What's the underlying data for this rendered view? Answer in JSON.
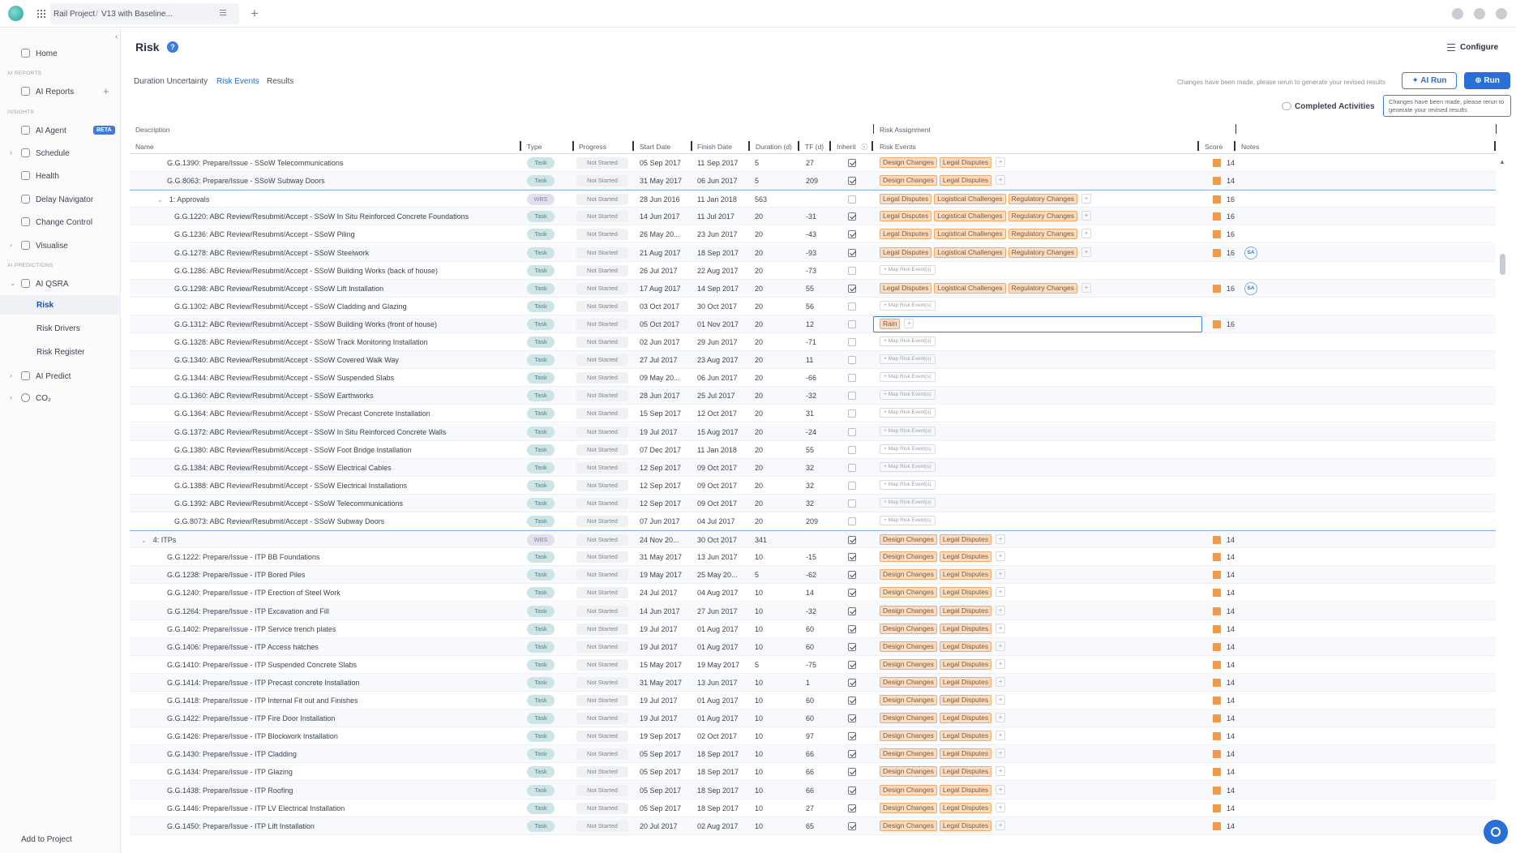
{
  "topbar": {
    "project": "Rail Project",
    "separator": "/",
    "version": "V13 with Baseline..."
  },
  "sidebar": {
    "home": "Home",
    "ai_reports_section": "AI REPORTS",
    "ai_reports": "AI Reports",
    "insights_section": "INSIGHTS",
    "ai_agent": "AI Agent",
    "beta": "BETA",
    "schedule": "Schedule",
    "health": "Health",
    "delay_navigator": "Delay Navigator",
    "change_control": "Change Control",
    "visualise": "Visualise",
    "ai_predictions_section": "AI PREDICTIONS",
    "ai_qsra": "AI QSRA",
    "risk": "Risk",
    "risk_drivers": "Risk Drivers",
    "risk_register": "Risk Register",
    "ai_predict": "AI Predict",
    "co2": "CO₂",
    "add_to_project": "Add to Project"
  },
  "header": {
    "title": "Risk",
    "help": "?",
    "configure": "Configure"
  },
  "subtabs": [
    "Duration Uncertainty",
    "Risk Events",
    "Results"
  ],
  "actions": {
    "notice": "Changes have been made, please rerun to generate your revised results",
    "ai_run": "AI Run",
    "run": "Run",
    "tooltip": "Changes have been made, please rerun to generate your revised results",
    "completed_activities": "Completed Activities"
  },
  "table": {
    "group_headers": {
      "description": "Description",
      "risk_assignment": "Risk Assignment"
    },
    "columns": {
      "name": "Name",
      "type": "Type",
      "progress": "Progress",
      "start": "Start Date",
      "finish": "Finish Date",
      "duration": "Duration (d)",
      "tf": "TF (d)",
      "inherit": "Inherit",
      "risk_events": "Risk Events",
      "score": "Score",
      "notes": "Notes"
    },
    "map_label": "+ Map Risk Event(s)",
    "rows": [
      {
        "name": "G.G.1390: Prepare/Issue - SSoW Telecommunications",
        "indent": 2,
        "type": "Task",
        "progress": "Not Started",
        "start": "05 Sep 2017",
        "finish": "11 Sep 2017",
        "dur": "5",
        "tf": "27",
        "inherit": true,
        "risks": [
          "Design Changes",
          "Legal Disputes"
        ],
        "score": "14"
      },
      {
        "name": "G.G.8063: Prepare/Issue - SSoW Subway Doors",
        "indent": 2,
        "type": "Task",
        "progress": "Not Started",
        "start": "31 May 2017",
        "finish": "06 Jun 2017",
        "dur": "5",
        "tf": "209",
        "inherit": true,
        "risks": [
          "Design Changes",
          "Legal Disputes"
        ],
        "score": "14"
      },
      {
        "name": "1: Approvals",
        "indent": 1,
        "wbs": true,
        "expander": "⌄",
        "type": "WBS",
        "progress": "Not Started",
        "start": "28 Jun 2016",
        "finish": "11 Jan 2018",
        "dur": "563",
        "tf": "",
        "inherit": false,
        "risks": [
          "Legal Disputes",
          "Logistical Challenges",
          "Regulatory Changes"
        ],
        "score": "16"
      },
      {
        "name": "G.G.1220: ABC Review/Resubmit/Accept - SSoW In Situ Reinforced Concrete Foundations",
        "indent": 3,
        "type": "Task",
        "progress": "Not Started",
        "start": "14 Jun 2017",
        "finish": "11 Jul 2017",
        "dur": "20",
        "tf": "-31",
        "inherit": true,
        "risks": [
          "Legal Disputes",
          "Logistical Challenges",
          "Regulatory Changes"
        ],
        "score": "16"
      },
      {
        "name": "G.G.1236: ABC Review/Resubmit/Accept - SSoW Piling",
        "indent": 3,
        "type": "Task",
        "progress": "Not Started",
        "start": "26 May 20...",
        "finish": "23 Jun 2017",
        "dur": "20",
        "tf": "-43",
        "inherit": true,
        "risks": [
          "Legal Disputes",
          "Logistical Challenges",
          "Regulatory Changes"
        ],
        "score": "16"
      },
      {
        "name": "G.G.1278: ABC Review/Resubmit/Accept - SSoW Steelwork",
        "indent": 3,
        "type": "Task",
        "progress": "Not Started",
        "start": "21 Aug 2017",
        "finish": "18 Sep 2017",
        "dur": "20",
        "tf": "-93",
        "inherit": true,
        "risks": [
          "Legal Disputes",
          "Logistical Challenges",
          "Regulatory Changes"
        ],
        "score": "16",
        "avatar": "SA"
      },
      {
        "name": "G.G.1286: ABC Review/Resubmit/Accept - SSoW Building Works (back of house)",
        "indent": 3,
        "type": "Task",
        "progress": "Not Started",
        "start": "26 Jul 2017",
        "finish": "22 Aug 2017",
        "dur": "20",
        "tf": "-73",
        "inherit": false,
        "map": true
      },
      {
        "name": "G.G.1298: ABC Review/Resubmit/Accept - SSoW Lift Installation",
        "indent": 3,
        "type": "Task",
        "progress": "Not Started",
        "start": "17 Aug 2017",
        "finish": "14 Sep 2017",
        "dur": "20",
        "tf": "55",
        "inherit": true,
        "risks": [
          "Legal Disputes",
          "Logistical Challenges",
          "Regulatory Changes"
        ],
        "score": "16",
        "avatar": "SA"
      },
      {
        "name": "G.G.1302: ABC Review/Resubmit/Accept - SSoW Cladding and Glazing",
        "indent": 3,
        "type": "Task",
        "progress": "Not Started",
        "start": "03 Oct 2017",
        "finish": "30 Oct 2017",
        "dur": "20",
        "tf": "56",
        "inherit": false,
        "map": true
      },
      {
        "name": "G.G.1312: ABC Review/Resubmit/Accept - SSoW Building Works (front of house)",
        "indent": 3,
        "type": "Task",
        "progress": "Not Started",
        "start": "05 Oct 2017",
        "finish": "01 Nov 2017",
        "dur": "20",
        "tf": "12",
        "inherit": false,
        "edit": true,
        "risks": [
          "Rain"
        ],
        "score": "16"
      },
      {
        "name": "G.G.1328: ABC Review/Resubmit/Accept - SSoW Track Monitoring Installation",
        "indent": 3,
        "type": "Task",
        "progress": "Not Started",
        "start": "02 Jun 2017",
        "finish": "29 Jun 2017",
        "dur": "20",
        "tf": "-71",
        "inherit": false,
        "map": true
      },
      {
        "name": "G.G.1340: ABC Review/Resubmit/Accept - SSoW Covered Walk Way",
        "indent": 3,
        "type": "Task",
        "progress": "Not Started",
        "start": "27 Jul 2017",
        "finish": "23 Aug 2017",
        "dur": "20",
        "tf": "11",
        "inherit": false,
        "map": true
      },
      {
        "name": "G.G.1344: ABC Review/Resubmit/Accept - SSoW Suspended Slabs",
        "indent": 3,
        "type": "Task",
        "progress": "Not Started",
        "start": "09 May 20...",
        "finish": "06 Jun 2017",
        "dur": "20",
        "tf": "-66",
        "inherit": false,
        "map": true
      },
      {
        "name": "G.G.1360: ABC Review/Resubmit/Accept - SSoW Earthworks",
        "indent": 3,
        "type": "Task",
        "progress": "Not Started",
        "start": "28 Jun 2017",
        "finish": "25 Jul 2017",
        "dur": "20",
        "tf": "-32",
        "inherit": false,
        "map": true
      },
      {
        "name": "G.G.1364: ABC Review/Resubmit/Accept - SSoW Precast Concrete Installation",
        "indent": 3,
        "type": "Task",
        "progress": "Not Started",
        "start": "15 Sep 2017",
        "finish": "12 Oct 2017",
        "dur": "20",
        "tf": "31",
        "inherit": false,
        "map": true
      },
      {
        "name": "G.G.1372: ABC Review/Resubmit/Accept - SSoW In Situ Reinforced Concrete Walls",
        "indent": 3,
        "type": "Task",
        "progress": "Not Started",
        "start": "19 Jul 2017",
        "finish": "15 Aug 2017",
        "dur": "20",
        "tf": "-24",
        "inherit": false,
        "map": true
      },
      {
        "name": "G.G.1380: ABC Review/Resubmit/Accept - SSoW Foot Bridge Installation",
        "indent": 3,
        "type": "Task",
        "progress": "Not Started",
        "start": "07 Dec 2017",
        "finish": "11 Jan 2018",
        "dur": "20",
        "tf": "55",
        "inherit": false,
        "map": true
      },
      {
        "name": "G.G.1384: ABC Review/Resubmit/Accept - SSoW Electrical Cables",
        "indent": 3,
        "type": "Task",
        "progress": "Not Started",
        "start": "12 Sep 2017",
        "finish": "09 Oct 2017",
        "dur": "20",
        "tf": "32",
        "inherit": false,
        "map": true
      },
      {
        "name": "G.G.1388: ABC Review/Resubmit/Accept - SSoW Electrical Installations",
        "indent": 3,
        "type": "Task",
        "progress": "Not Started",
        "start": "12 Sep 2017",
        "finish": "09 Oct 2017",
        "dur": "20",
        "tf": "32",
        "inherit": false,
        "map": true
      },
      {
        "name": "G.G.1392: ABC Review/Resubmit/Accept - SSoW Telecommunications",
        "indent": 3,
        "type": "Task",
        "progress": "Not Started",
        "start": "12 Sep 2017",
        "finish": "09 Oct 2017",
        "dur": "20",
        "tf": "32",
        "inherit": false,
        "map": true
      },
      {
        "name": "G.G.8073: ABC Review/Resubmit/Accept - SSoW Subway Doors",
        "indent": 3,
        "type": "Task",
        "progress": "Not Started",
        "start": "07 Jun 2017",
        "finish": "04 Jul 2017",
        "dur": "20",
        "tf": "209",
        "inherit": false,
        "map": true
      },
      {
        "name": "4: ITPs",
        "indent": 0,
        "wbs": true,
        "expander": "⌄",
        "type": "WBS",
        "progress": "Not Started",
        "start": "24 Nov 20...",
        "finish": "30 Oct 2017",
        "dur": "341",
        "tf": "",
        "inherit": true,
        "risks": [
          "Design Changes",
          "Legal Disputes"
        ],
        "score": "14"
      },
      {
        "name": "G.G.1222: Prepare/Issue - ITP BB Foundations",
        "indent": 2,
        "type": "Task",
        "progress": "Not Started",
        "start": "31 May 2017",
        "finish": "13 Jun 2017",
        "dur": "10",
        "tf": "-15",
        "inherit": true,
        "risks": [
          "Design Changes",
          "Legal Disputes"
        ],
        "score": "14"
      },
      {
        "name": "G.G.1238: Prepare/Issue - ITP Bored Piles",
        "indent": 2,
        "type": "Task",
        "progress": "Not Started",
        "start": "19 May 2017",
        "finish": "25 May 20...",
        "dur": "5",
        "tf": "-62",
        "inherit": true,
        "risks": [
          "Design Changes",
          "Legal Disputes"
        ],
        "score": "14"
      },
      {
        "name": "G.G.1240: Prepare/Issue - ITP Erection of Steel Work",
        "indent": 2,
        "type": "Task",
        "progress": "Not Started",
        "start": "24 Jul 2017",
        "finish": "04 Aug 2017",
        "dur": "10",
        "tf": "14",
        "inherit": true,
        "risks": [
          "Design Changes",
          "Legal Disputes"
        ],
        "score": "14"
      },
      {
        "name": "G.G.1264: Prepare/Issue - ITP Excavation and Fill",
        "indent": 2,
        "type": "Task",
        "progress": "Not Started",
        "start": "14 Jun 2017",
        "finish": "27 Jun 2017",
        "dur": "10",
        "tf": "-32",
        "inherit": true,
        "risks": [
          "Design Changes",
          "Legal Disputes"
        ],
        "score": "14"
      },
      {
        "name": "G.G.1402: Prepare/Issue - ITP Service trench plates",
        "indent": 2,
        "type": "Task",
        "progress": "Not Started",
        "start": "19 Jul 2017",
        "finish": "01 Aug 2017",
        "dur": "10",
        "tf": "60",
        "inherit": true,
        "risks": [
          "Design Changes",
          "Legal Disputes"
        ],
        "score": "14"
      },
      {
        "name": "G.G.1406: Prepare/Issue - ITP Access hatches",
        "indent": 2,
        "type": "Task",
        "progress": "Not Started",
        "start": "19 Jul 2017",
        "finish": "01 Aug 2017",
        "dur": "10",
        "tf": "60",
        "inherit": true,
        "risks": [
          "Design Changes",
          "Legal Disputes"
        ],
        "score": "14"
      },
      {
        "name": "G.G.1410: Prepare/Issue - ITP Suspended Concrete Slabs",
        "indent": 2,
        "type": "Task",
        "progress": "Not Started",
        "start": "15 May 2017",
        "finish": "19 May 2017",
        "dur": "5",
        "tf": "-75",
        "inherit": true,
        "risks": [
          "Design Changes",
          "Legal Disputes"
        ],
        "score": "14"
      },
      {
        "name": "G.G.1414: Prepare/Issue - ITP Precast concrete Installation",
        "indent": 2,
        "type": "Task",
        "progress": "Not Started",
        "start": "31 May 2017",
        "finish": "13 Jun 2017",
        "dur": "10",
        "tf": "1",
        "inherit": true,
        "risks": [
          "Design Changes",
          "Legal Disputes"
        ],
        "score": "14"
      },
      {
        "name": "G.G.1418: Prepare/Issue - ITP Internal Fit out and Finishes",
        "indent": 2,
        "type": "Task",
        "progress": "Not Started",
        "start": "19 Jul 2017",
        "finish": "01 Aug 2017",
        "dur": "10",
        "tf": "60",
        "inherit": true,
        "risks": [
          "Design Changes",
          "Legal Disputes"
        ],
        "score": "14"
      },
      {
        "name": "G.G.1422: Prepare/Issue - ITP Fire Door Installation",
        "indent": 2,
        "type": "Task",
        "progress": "Not Started",
        "start": "19 Jul 2017",
        "finish": "01 Aug 2017",
        "dur": "10",
        "tf": "60",
        "inherit": true,
        "risks": [
          "Design Changes",
          "Legal Disputes"
        ],
        "score": "14"
      },
      {
        "name": "G.G.1426: Prepare/Issue - ITP Blockwork Installation",
        "indent": 2,
        "type": "Task",
        "progress": "Not Started",
        "start": "19 Sep 2017",
        "finish": "02 Oct 2017",
        "dur": "10",
        "tf": "97",
        "inherit": true,
        "risks": [
          "Design Changes",
          "Legal Disputes"
        ],
        "score": "14"
      },
      {
        "name": "G.G.1430: Prepare/Issue - ITP Cladding",
        "indent": 2,
        "type": "Task",
        "progress": "Not Started",
        "start": "05 Sep 2017",
        "finish": "18 Sep 2017",
        "dur": "10",
        "tf": "66",
        "inherit": true,
        "risks": [
          "Design Changes",
          "Legal Disputes"
        ],
        "score": "14"
      },
      {
        "name": "G.G.1434: Prepare/Issue - ITP Glazing",
        "indent": 2,
        "type": "Task",
        "progress": "Not Started",
        "start": "05 Sep 2017",
        "finish": "18 Sep 2017",
        "dur": "10",
        "tf": "66",
        "inherit": true,
        "risks": [
          "Design Changes",
          "Legal Disputes"
        ],
        "score": "14"
      },
      {
        "name": "G.G.1438: Prepare/Issue - ITP Roofing",
        "indent": 2,
        "type": "Task",
        "progress": "Not Started",
        "start": "05 Sep 2017",
        "finish": "18 Sep 2017",
        "dur": "10",
        "tf": "66",
        "inherit": true,
        "risks": [
          "Design Changes",
          "Legal Disputes"
        ],
        "score": "14"
      },
      {
        "name": "G.G.1446: Prepare/Issue - ITP LV Electrical Installation",
        "indent": 2,
        "type": "Task",
        "progress": "Not Started",
        "start": "05 Sep 2017",
        "finish": "18 Sep 2017",
        "dur": "10",
        "tf": "27",
        "inherit": true,
        "risks": [
          "Design Changes",
          "Legal Disputes"
        ],
        "score": "14"
      },
      {
        "name": "G.G.1450: Prepare/Issue - ITP Lift Installation",
        "indent": 2,
        "type": "Task",
        "progress": "Not Started",
        "start": "20 Jul 2017",
        "finish": "02 Aug 2017",
        "dur": "10",
        "tf": "65",
        "inherit": true,
        "risks": [
          "Design Changes",
          "Legal Disputes"
        ],
        "score": "14"
      }
    ]
  }
}
